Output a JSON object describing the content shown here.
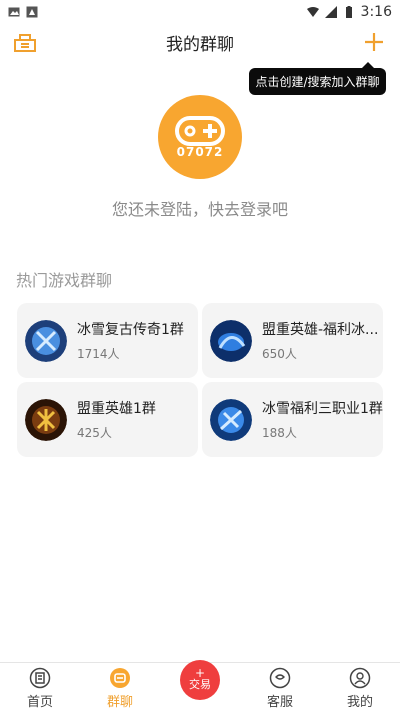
{
  "status_bar": {
    "time": "3:16"
  },
  "header": {
    "title": "我的群聊"
  },
  "tooltip": {
    "text": "点击创建/搜索加入群聊"
  },
  "profile": {
    "code": "07072",
    "login_tip": "您还未登陆，快去登录吧"
  },
  "section": {
    "title": "热门游戏群聊"
  },
  "groups": [
    {
      "name": "冰雪复古传奇1群",
      "count": "1714人"
    },
    {
      "name": "盟重英雄-福利冰...",
      "count": "650人"
    },
    {
      "name": "盟重英雄1群",
      "count": "425人"
    },
    {
      "name": "冰雪福利三职业1群",
      "count": "188人"
    }
  ],
  "tabs": [
    {
      "label": "首页"
    },
    {
      "label": "群聊"
    },
    {
      "label": "交易"
    },
    {
      "label": "客服"
    },
    {
      "label": "我的"
    }
  ],
  "colors": {
    "accent": "#f8a630",
    "trade": "#ef3e3e"
  }
}
